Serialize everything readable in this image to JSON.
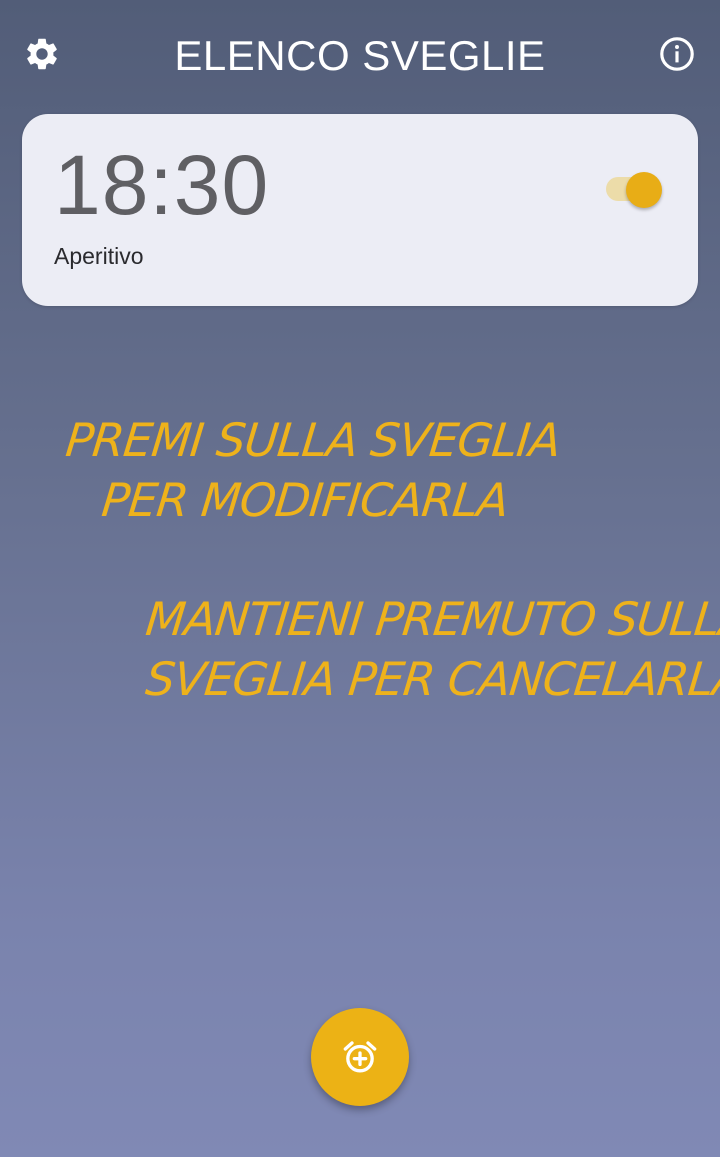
{
  "app_bar": {
    "title": "ELENCO SVEGLIE",
    "settings_icon": "gear-icon",
    "info_icon": "info-circle-icon"
  },
  "alarms": [
    {
      "time": "18:30",
      "label": "Aperitivo",
      "enabled": true
    }
  ],
  "hints": {
    "edit_line1": "PREMI SULLA SVEGLIA",
    "edit_line2": "PER MODIFICARLA",
    "delete_line1": "MANTIENI PREMUTO SULLA",
    "delete_line2": "SVEGLIA PER CANCELARLA"
  },
  "fab": {
    "icon": "alarm-add-icon"
  },
  "colors": {
    "accent": "#ecb215",
    "card_background": "#ecedf5",
    "background_top": "#525d78",
    "background_bottom": "#8089b5",
    "title_text": "#ffffff"
  }
}
